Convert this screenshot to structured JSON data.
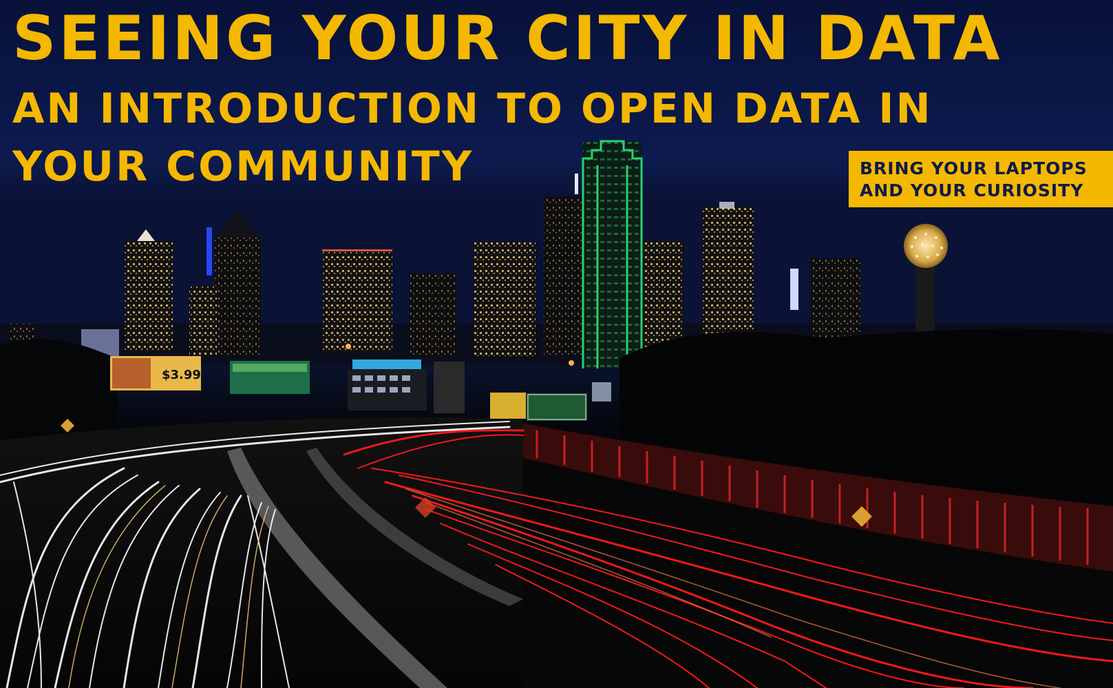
{
  "poster": {
    "title": "SEEING YOUR CITY IN DATA",
    "subtitle_line1": "AN INTRODUCTION TO OPEN DATA IN",
    "subtitle_line2": "YOUR COMMUNITY",
    "callout": {
      "line1": "BRING YOUR LAPTOPS",
      "line2": "AND YOUR CURIOSITY"
    },
    "colors": {
      "accent": "#f5b800",
      "sky": "#0b1640",
      "callout_text": "#0d1a4a",
      "light_trail_red": "#ff1a1a",
      "light_trail_white": "#ffffff",
      "building_green": "#2bd16a"
    }
  }
}
